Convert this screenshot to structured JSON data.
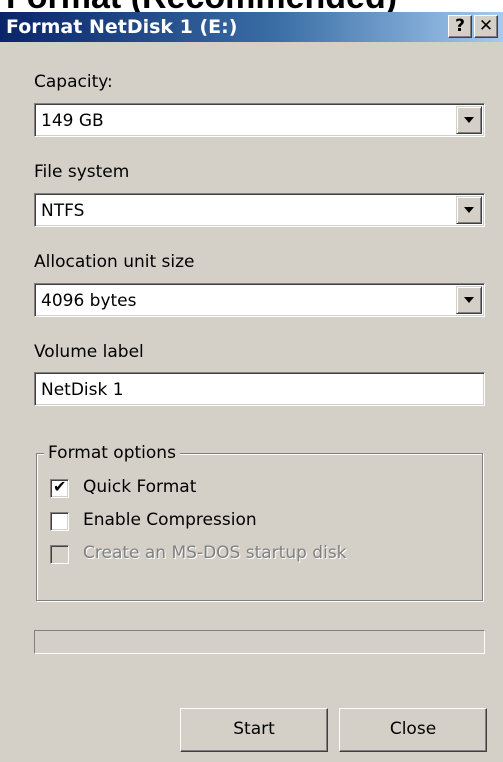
{
  "background_caption": "Format (Recommended)",
  "window": {
    "title": "Format NetDisk 1 (E:)",
    "help_button": "?",
    "close_button": "✕"
  },
  "capacity": {
    "label": "Capacity:",
    "value": "149 GB"
  },
  "file_system": {
    "label": "File system",
    "value": "NTFS"
  },
  "allocation": {
    "label": "Allocation unit size",
    "value": "4096 bytes"
  },
  "volume": {
    "label": "Volume label",
    "value": "NetDisk 1"
  },
  "format_options": {
    "title": "Format options",
    "quick_format": {
      "label": "Quick Format",
      "checked": true,
      "enabled": true
    },
    "compression": {
      "label": "Enable Compression",
      "checked": false,
      "enabled": true
    },
    "msdos": {
      "label": "Create an MS-DOS startup disk",
      "checked": false,
      "enabled": false
    }
  },
  "progress": {
    "fraction": 0.0
  },
  "buttons": {
    "start": "Start",
    "close": "Close"
  },
  "colors": {
    "titlebar_start": "#0a246a",
    "titlebar_end": "#a6caf0",
    "face": "#d4d0c8"
  }
}
